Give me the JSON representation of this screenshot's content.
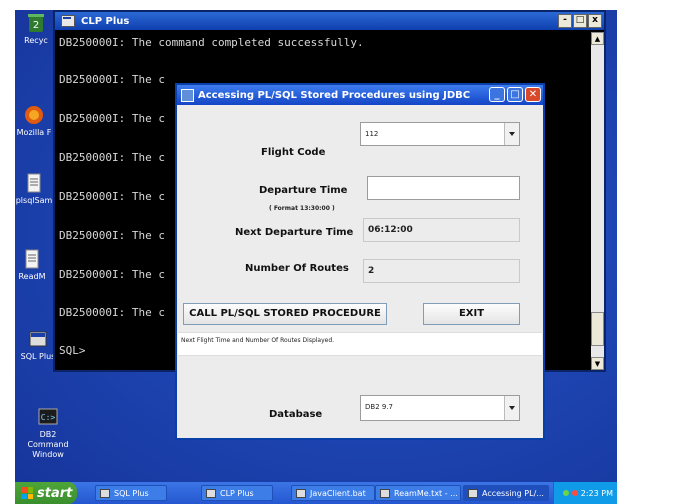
{
  "console": {
    "title": "CLP Plus",
    "controls": [
      "-",
      "□",
      "x"
    ],
    "lines": [
      "DB250000I: The command completed successfully.",
      "DB250000I: The c",
      "DB250000I: The c",
      "DB250000I: The c",
      "DB250000I: The c",
      "DB250000I: The c",
      "DB250000I: The c",
      "DB250000I: The c",
      "SQL>"
    ]
  },
  "desktop": {
    "icons": [
      {
        "name": "recycle-bin-icon",
        "label": "Recyc"
      },
      {
        "name": "mozilla-icon",
        "label": "Mozilla F"
      },
      {
        "name": "plsql-icon",
        "label": "plsqlSam"
      },
      {
        "name": "readme-icon",
        "label": "ReadM"
      },
      {
        "name": "sql-plus-icon",
        "label": "SQL Plus"
      },
      {
        "name": "db2-command-window-icon",
        "label": "DB2 Command Window"
      }
    ]
  },
  "dialog": {
    "title": "Accessing PL/SQL Stored Procedures using JDBC",
    "flight_code_label": "Flight Code",
    "flight_code_value": "112",
    "departure_time_label": "Departure Time",
    "departure_time_hint": "( Format 13:30:00 )",
    "departure_time_value": "",
    "next_departure_label": "Next Departure Time",
    "next_departure_value": "06:12:00",
    "routes_label": "Number Of Routes",
    "routes_value": "2",
    "call_button": "CALL PL/SQL STORED PROCEDURE",
    "exit_button": "EXIT",
    "status_text": "Next Flight Time and Number Of Routes Displayed.",
    "database_label": "Database",
    "database_value": "DB2 9.7"
  },
  "taskbar": {
    "start_label": "start",
    "tasks": [
      "SQL Plus",
      "CLP Plus",
      "JavaClient.bat",
      "ReamMe.txt - ...",
      "Accessing PL/..."
    ],
    "clock": "2:23 PM",
    "colors": {
      "taskbar": "#2557d0",
      "start": "#3a8f2d",
      "tray": "#0f9be8"
    }
  }
}
